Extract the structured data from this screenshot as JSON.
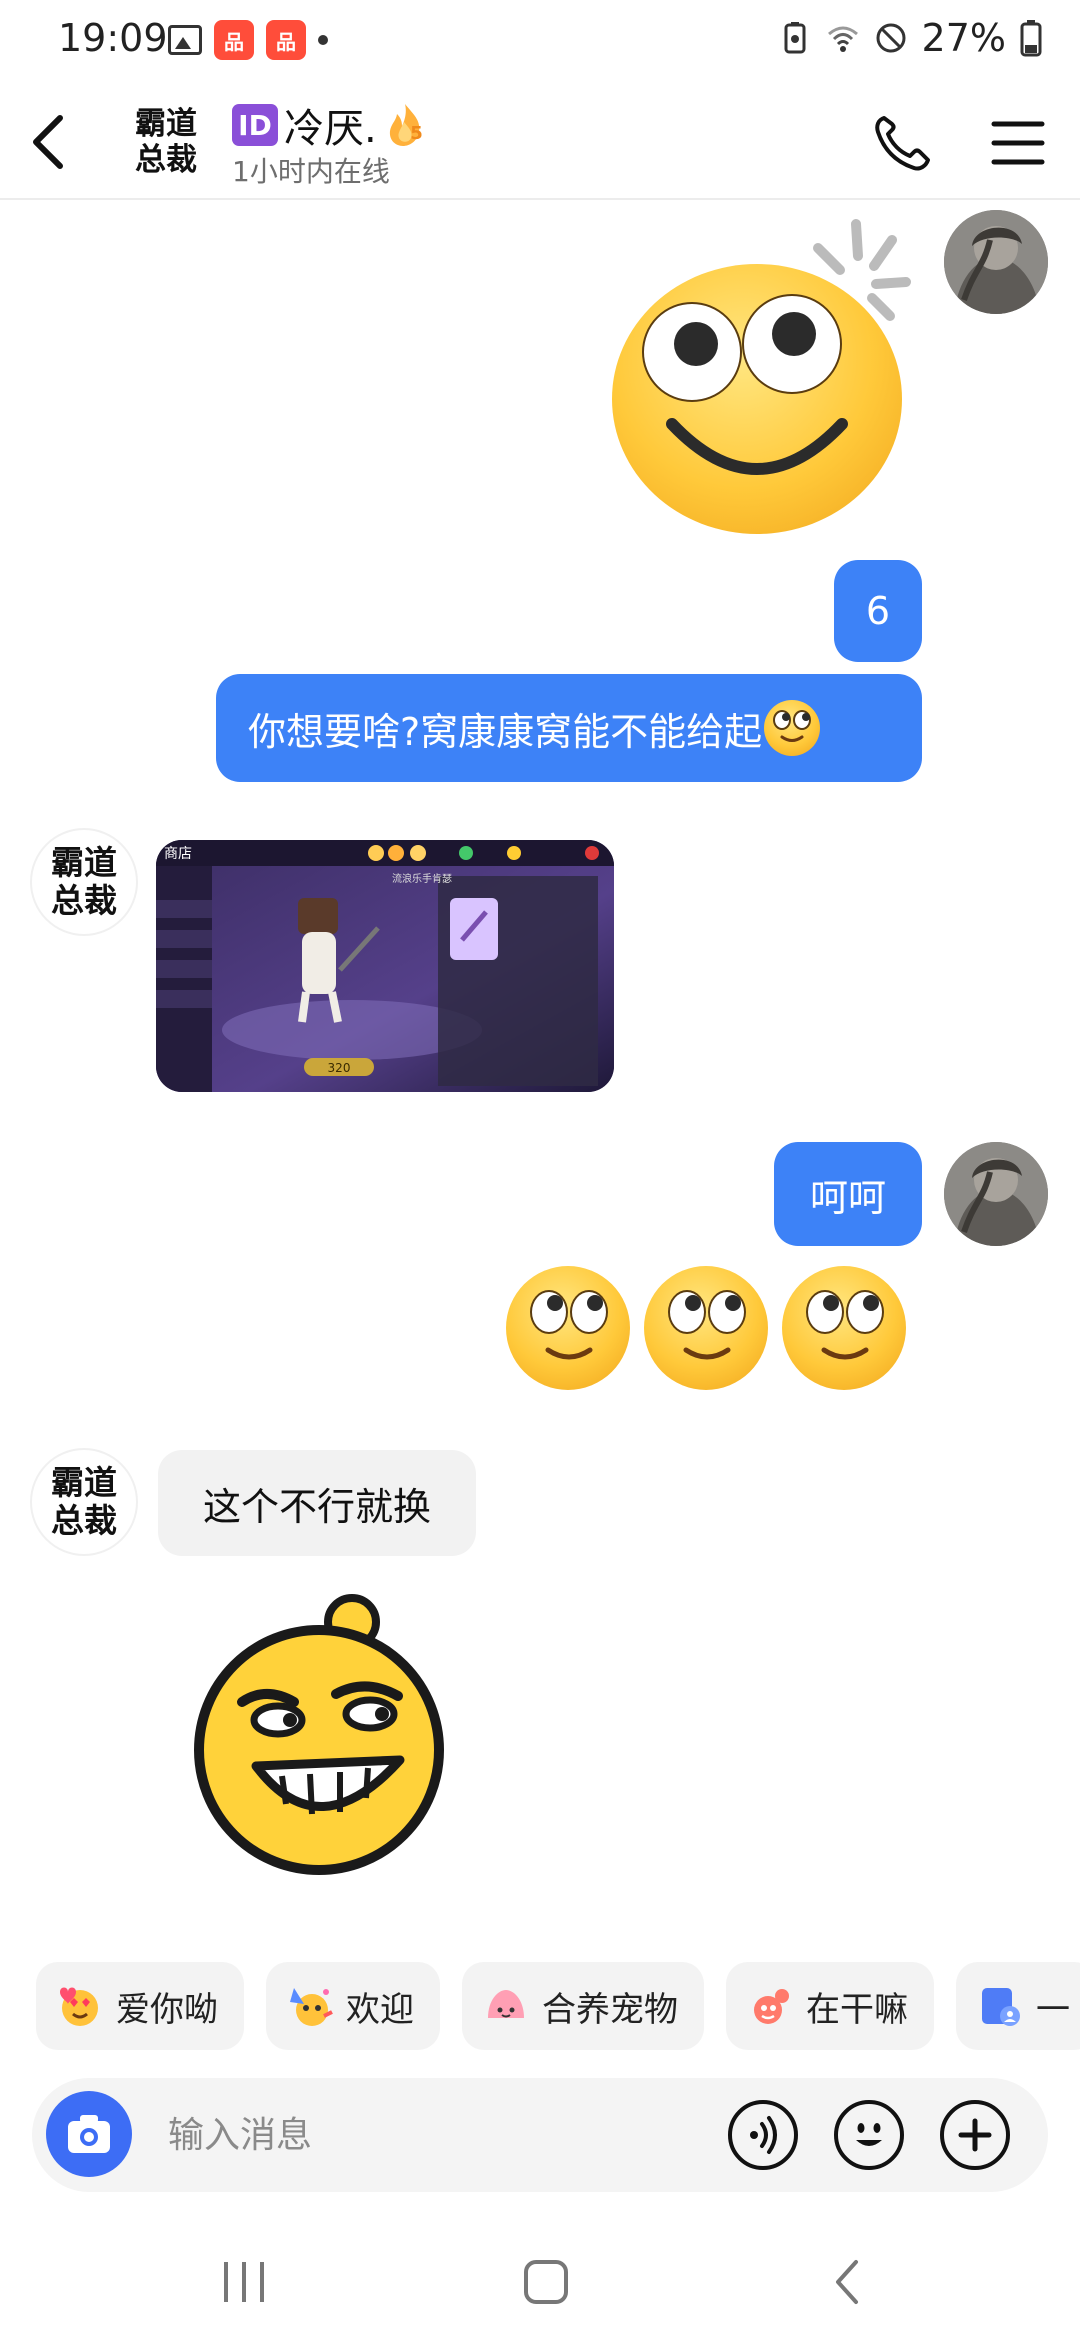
{
  "status_bar": {
    "time": "19:09",
    "battery": "27%",
    "app_icon_text": "品",
    "icons": [
      "gallery-icon",
      "app-notification-icon",
      "app-notification-icon",
      "dot-icon",
      "battery-saver-icon",
      "wifi-icon",
      "do-not-disturb-icon",
      "battery-icon"
    ]
  },
  "header": {
    "avatar_line1": "霸道",
    "avatar_line2": "总裁",
    "id_badge": "ID",
    "name": "冷厌.",
    "flame_level": "5",
    "status": "1小时内在线"
  },
  "messages": [
    {
      "from": "me",
      "type": "sticker",
      "sticker": "smiling-face-sticker"
    },
    {
      "from": "me",
      "type": "text",
      "text": "6"
    },
    {
      "from": "me",
      "type": "text",
      "text": "你想要啥?窝康康窝能不能给起",
      "emoji": "eye-roll-emoji"
    },
    {
      "from": "them",
      "type": "image",
      "avatar_line1": "霸道",
      "avatar_line2": "总裁"
    },
    {
      "from": "me",
      "type": "text",
      "text": "呵呵"
    },
    {
      "from": "me",
      "type": "emoji-row",
      "emoji": "eye-roll-emoji",
      "count": 3
    },
    {
      "from": "them",
      "type": "text",
      "text": "这个不行就换",
      "avatar_line1": "霸道",
      "avatar_line2": "总裁"
    },
    {
      "from": "them",
      "type": "sticker",
      "sticker": "grinning-face-sticker"
    }
  ],
  "screenshot_game": {
    "shop_label": "商店",
    "currency": "320",
    "search_label": "流浪乐手肯瑟"
  },
  "quick_replies": [
    {
      "label": "爱你呦",
      "icon": "heart-eyes-icon"
    },
    {
      "label": "欢迎",
      "icon": "party-face-icon"
    },
    {
      "label": "合养宠物",
      "icon": "pet-icon"
    },
    {
      "label": "在干嘛",
      "icon": "game-icon"
    },
    {
      "label": "一",
      "icon": "photo-icon"
    }
  ],
  "input": {
    "placeholder": "输入消息"
  },
  "colors": {
    "accent": "#3d82f7",
    "camera": "#3d6df5",
    "bubble_in": "#f2f2f2"
  }
}
